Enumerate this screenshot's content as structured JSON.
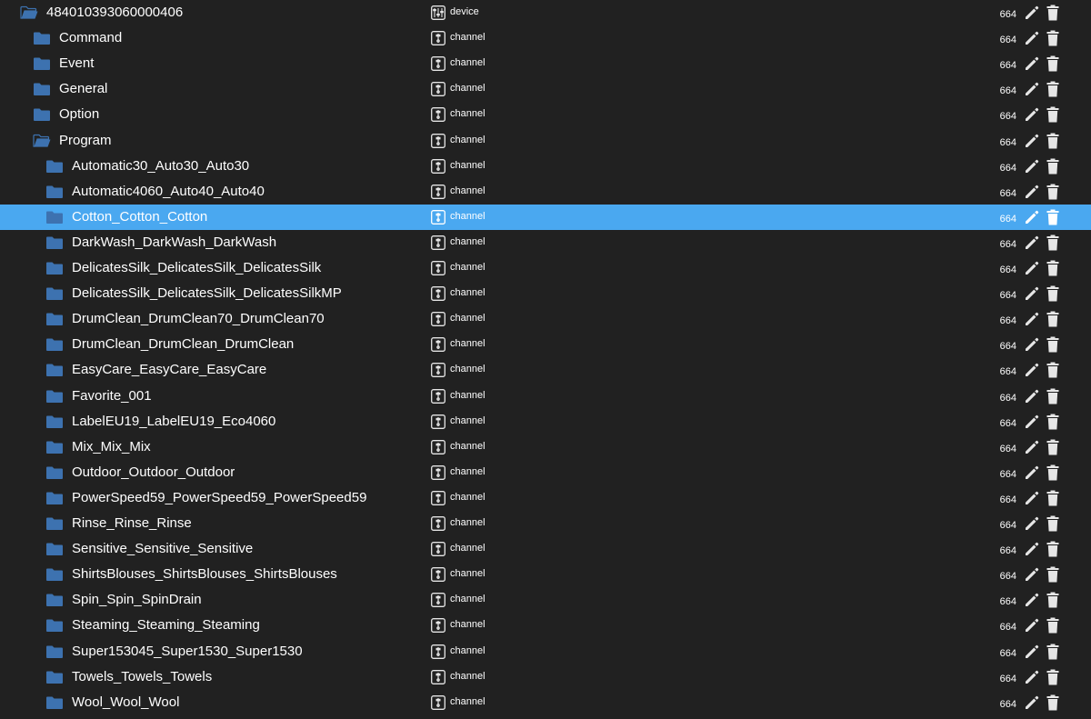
{
  "colors": {
    "background": "#212121",
    "selected": "#4aa8f0",
    "folder": "#3d72b0",
    "icon": "#e6e6e6"
  },
  "icons": {
    "folder": "folder-icon",
    "folder_open": "folder-open-icon",
    "device": "device-icon",
    "channel": "channel-icon",
    "edit": "pencil-icon",
    "delete": "trash-icon"
  },
  "tree": {
    "rows": [
      {
        "name": "484010393060000406",
        "level": 0,
        "open": true,
        "type": "device",
        "acl": "664",
        "selected": false
      },
      {
        "name": "Command",
        "level": 1,
        "open": false,
        "type": "channel",
        "acl": "664",
        "selected": false
      },
      {
        "name": "Event",
        "level": 1,
        "open": false,
        "type": "channel",
        "acl": "664",
        "selected": false
      },
      {
        "name": "General",
        "level": 1,
        "open": false,
        "type": "channel",
        "acl": "664",
        "selected": false
      },
      {
        "name": "Option",
        "level": 1,
        "open": false,
        "type": "channel",
        "acl": "664",
        "selected": false
      },
      {
        "name": "Program",
        "level": 1,
        "open": true,
        "type": "channel",
        "acl": "664",
        "selected": false
      },
      {
        "name": "Automatic30_Auto30_Auto30",
        "level": 2,
        "open": false,
        "type": "channel",
        "acl": "664",
        "selected": false
      },
      {
        "name": "Automatic4060_Auto40_Auto40",
        "level": 2,
        "open": false,
        "type": "channel",
        "acl": "664",
        "selected": false
      },
      {
        "name": "Cotton_Cotton_Cotton",
        "level": 2,
        "open": false,
        "type": "channel",
        "acl": "664",
        "selected": true
      },
      {
        "name": "DarkWash_DarkWash_DarkWash",
        "level": 2,
        "open": false,
        "type": "channel",
        "acl": "664",
        "selected": false
      },
      {
        "name": "DelicatesSilk_DelicatesSilk_DelicatesSilk",
        "level": 2,
        "open": false,
        "type": "channel",
        "acl": "664",
        "selected": false
      },
      {
        "name": "DelicatesSilk_DelicatesSilk_DelicatesSilkMP",
        "level": 2,
        "open": false,
        "type": "channel",
        "acl": "664",
        "selected": false
      },
      {
        "name": "DrumClean_DrumClean70_DrumClean70",
        "level": 2,
        "open": false,
        "type": "channel",
        "acl": "664",
        "selected": false
      },
      {
        "name": "DrumClean_DrumClean_DrumClean",
        "level": 2,
        "open": false,
        "type": "channel",
        "acl": "664",
        "selected": false
      },
      {
        "name": "EasyCare_EasyCare_EasyCare",
        "level": 2,
        "open": false,
        "type": "channel",
        "acl": "664",
        "selected": false
      },
      {
        "name": "Favorite_001",
        "level": 2,
        "open": false,
        "type": "channel",
        "acl": "664",
        "selected": false
      },
      {
        "name": "LabelEU19_LabelEU19_Eco4060",
        "level": 2,
        "open": false,
        "type": "channel",
        "acl": "664",
        "selected": false
      },
      {
        "name": "Mix_Mix_Mix",
        "level": 2,
        "open": false,
        "type": "channel",
        "acl": "664",
        "selected": false
      },
      {
        "name": "Outdoor_Outdoor_Outdoor",
        "level": 2,
        "open": false,
        "type": "channel",
        "acl": "664",
        "selected": false
      },
      {
        "name": "PowerSpeed59_PowerSpeed59_PowerSpeed59",
        "level": 2,
        "open": false,
        "type": "channel",
        "acl": "664",
        "selected": false
      },
      {
        "name": "Rinse_Rinse_Rinse",
        "level": 2,
        "open": false,
        "type": "channel",
        "acl": "664",
        "selected": false
      },
      {
        "name": "Sensitive_Sensitive_Sensitive",
        "level": 2,
        "open": false,
        "type": "channel",
        "acl": "664",
        "selected": false
      },
      {
        "name": "ShirtsBlouses_ShirtsBlouses_ShirtsBlouses",
        "level": 2,
        "open": false,
        "type": "channel",
        "acl": "664",
        "selected": false
      },
      {
        "name": "Spin_Spin_SpinDrain",
        "level": 2,
        "open": false,
        "type": "channel",
        "acl": "664",
        "selected": false
      },
      {
        "name": "Steaming_Steaming_Steaming",
        "level": 2,
        "open": false,
        "type": "channel",
        "acl": "664",
        "selected": false
      },
      {
        "name": "Super153045_Super1530_Super1530",
        "level": 2,
        "open": false,
        "type": "channel",
        "acl": "664",
        "selected": false
      },
      {
        "name": "Towels_Towels_Towels",
        "level": 2,
        "open": false,
        "type": "channel",
        "acl": "664",
        "selected": false
      },
      {
        "name": "Wool_Wool_Wool",
        "level": 2,
        "open": false,
        "type": "channel",
        "acl": "664",
        "selected": false
      }
    ]
  }
}
